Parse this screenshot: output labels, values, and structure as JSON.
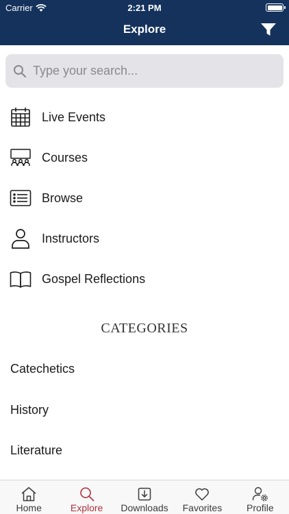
{
  "status_bar": {
    "carrier": "Carrier",
    "time": "2:21 PM"
  },
  "header": {
    "title": "Explore"
  },
  "search": {
    "placeholder": "Type your search..."
  },
  "menu": {
    "items": [
      {
        "label": "Live Events",
        "icon": "calendar-icon"
      },
      {
        "label": "Courses",
        "icon": "classroom-icon"
      },
      {
        "label": "Browse",
        "icon": "list-icon"
      },
      {
        "label": "Instructors",
        "icon": "person-icon"
      },
      {
        "label": "Gospel Reflections",
        "icon": "book-icon"
      }
    ]
  },
  "categories": {
    "heading": "CATEGORIES",
    "items": [
      "Catechetics",
      "History",
      "Literature"
    ]
  },
  "tabbar": {
    "items": [
      {
        "label": "Home",
        "icon": "home-icon"
      },
      {
        "label": "Explore",
        "icon": "search-icon",
        "active": true
      },
      {
        "label": "Downloads",
        "icon": "download-icon"
      },
      {
        "label": "Favorites",
        "icon": "heart-icon"
      },
      {
        "label": "Profile",
        "icon": "profile-settings-icon"
      }
    ]
  },
  "colors": {
    "header_bg": "#14325c",
    "accent": "#b0313b"
  }
}
